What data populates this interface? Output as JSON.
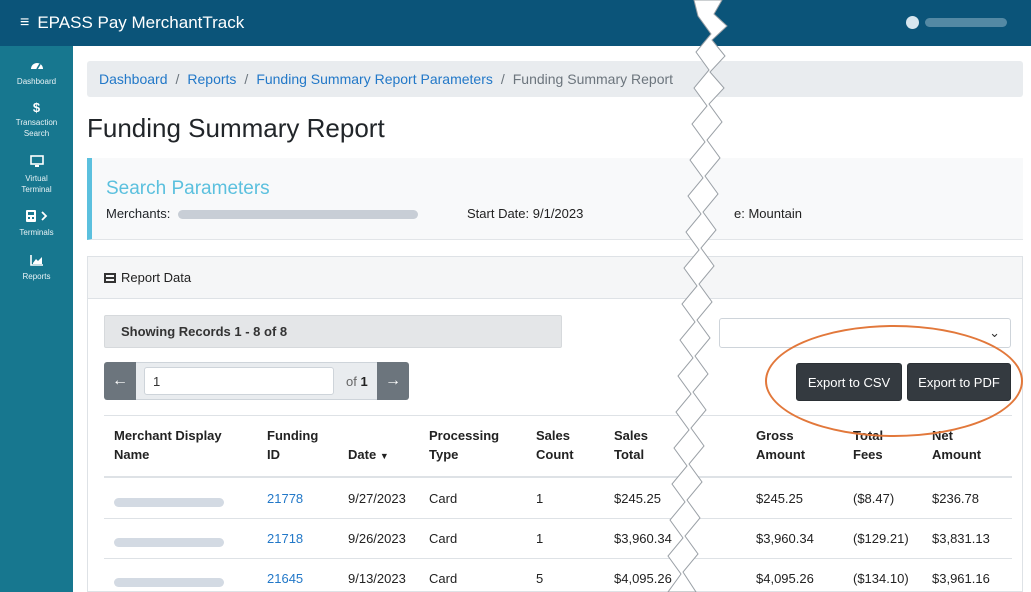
{
  "app": {
    "title": "EPASS Pay MerchantTrack",
    "menu_icon": "hamburger-icon",
    "user_icon": "user-circle-icon"
  },
  "sidebar": {
    "items": [
      {
        "label": "Dashboard",
        "icon": "dashboard-icon"
      },
      {
        "label": "Transaction Search",
        "icon": "dollar-icon"
      },
      {
        "label": "Virtual Terminal",
        "icon": "monitor-icon"
      },
      {
        "label": "Terminals",
        "icon": "calculator-icon"
      },
      {
        "label": "Reports",
        "icon": "chart-icon"
      }
    ]
  },
  "breadcrumb": {
    "items": [
      "Dashboard",
      "Reports",
      "Funding Summary Report Parameters"
    ],
    "current": "Funding Summary Report",
    "separator": "/"
  },
  "page": {
    "title": "Funding Summary Report"
  },
  "search_params": {
    "title": "Search Parameters",
    "merchants_label": "Merchants:",
    "start_date": "Start Date: 9/1/2023",
    "timezone": "e: Mountain"
  },
  "report": {
    "header": "Report Data",
    "showing": "Showing Records 1 - 8 of 8",
    "pager": {
      "prev": "←",
      "next": "→",
      "page": "1",
      "of_label": "of",
      "total": "1"
    },
    "export_csv": "Export to CSV",
    "export_pdf": "Export to PDF",
    "select_chevron": "⌄",
    "columns": [
      {
        "l1": "Merchant Display",
        "l2": "Name"
      },
      {
        "l1": "Funding",
        "l2": "ID"
      },
      {
        "l1": "",
        "l2": "Date"
      },
      {
        "l1": "Processing",
        "l2": "Type"
      },
      {
        "l1": "Sales",
        "l2": "Count"
      },
      {
        "l1": "Sales",
        "l2": "Total"
      },
      {
        "l1": "Gross",
        "l2": "Amount"
      },
      {
        "l1": "Total",
        "l2": "Fees"
      },
      {
        "l1": "Net",
        "l2": "Amount"
      }
    ],
    "sort_indicator": "▼",
    "rows": [
      {
        "funding_id": "21778",
        "date": "9/27/2023",
        "type": "Card",
        "count": "1",
        "sales_total": "$245.25",
        "gross": "$245.25",
        "fees": "($8.47)",
        "net": "$236.78"
      },
      {
        "funding_id": "21718",
        "date": "9/26/2023",
        "type": "Card",
        "count": "1",
        "sales_total": "$3,960.34",
        "gross": "$3,960.34",
        "fees": "($129.21)",
        "net": "$3,831.13"
      },
      {
        "funding_id": "21645",
        "date": "9/13/2023",
        "type": "Card",
        "count": "5",
        "sales_total": "$4,095.26",
        "gross": "$4,095.26",
        "fees": "($134.10)",
        "net": "$3,961.16"
      }
    ]
  },
  "colors": {
    "topbar": "#0b5479",
    "sidebar": "#17778f",
    "link": "#2278c8",
    "accent": "#5bc0de",
    "highlight": "#e2783b"
  }
}
